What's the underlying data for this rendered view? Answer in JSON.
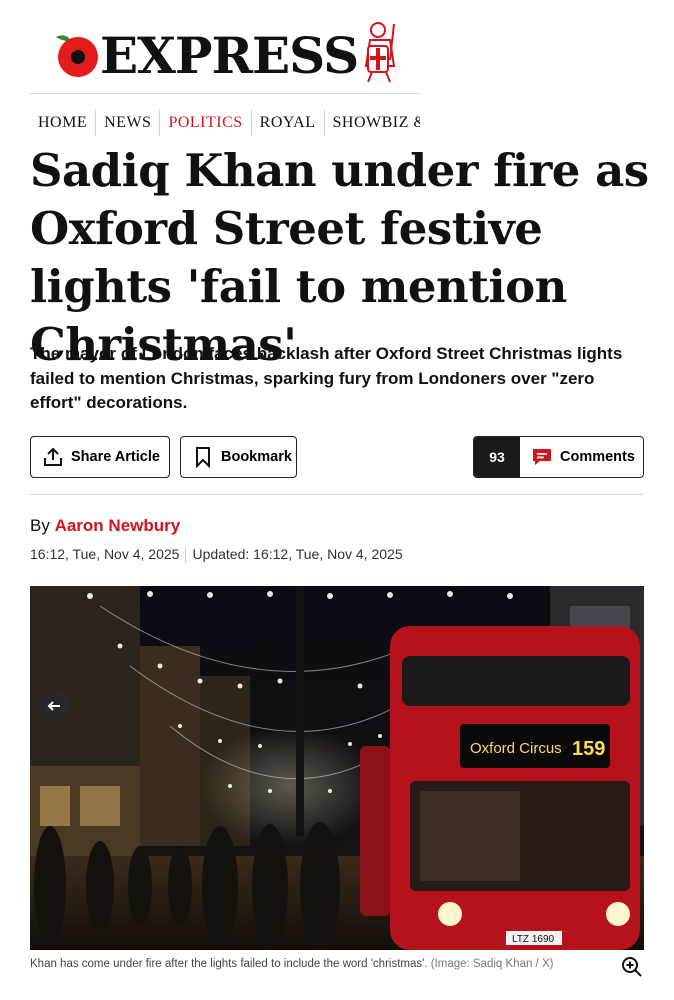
{
  "brand": {
    "name": "EXPRESS",
    "accent": "#d2141c"
  },
  "nav": {
    "items": [
      {
        "label": "HOME"
      },
      {
        "label": "NEWS"
      },
      {
        "label": "POLITICS"
      },
      {
        "label": "ROYAL"
      },
      {
        "label": "SHOWBIZ & TV"
      }
    ],
    "active": "POLITICS"
  },
  "article": {
    "headline": "Sadiq Khan under fire as Oxford Street festive lights 'fail to mention Christmas'",
    "standfirst": "The mayor of London faces backlash after Oxford Street Christmas lights failed to mention Christmas, sparking fury from Londoners over \"zero effort\" decorations.",
    "byline_prefix": "By",
    "author": "Aaron Newbury",
    "published": "16:12, Tue, Nov 4, 2025",
    "updated": "Updated: 16:12, Tue, Nov 4, 2025"
  },
  "actions": {
    "share_label": "Share Article",
    "bookmark_label": "Bookmark",
    "comments_count": "93",
    "comments_label": "Comments"
  },
  "image": {
    "bus_destination": "Oxford Circus",
    "bus_route": "159",
    "bus_plate": "LTZ 1690",
    "caption": "Khan has come under fire after the lights failed to include the word 'christmas'.",
    "credit": "(Image: Sadiq Khan / X)"
  },
  "icons": {
    "share": "share-icon",
    "bookmark": "bookmark-icon",
    "comments": "comment-bubble-icon",
    "prev": "arrow-left-icon",
    "zoom": "zoom-in-icon"
  }
}
